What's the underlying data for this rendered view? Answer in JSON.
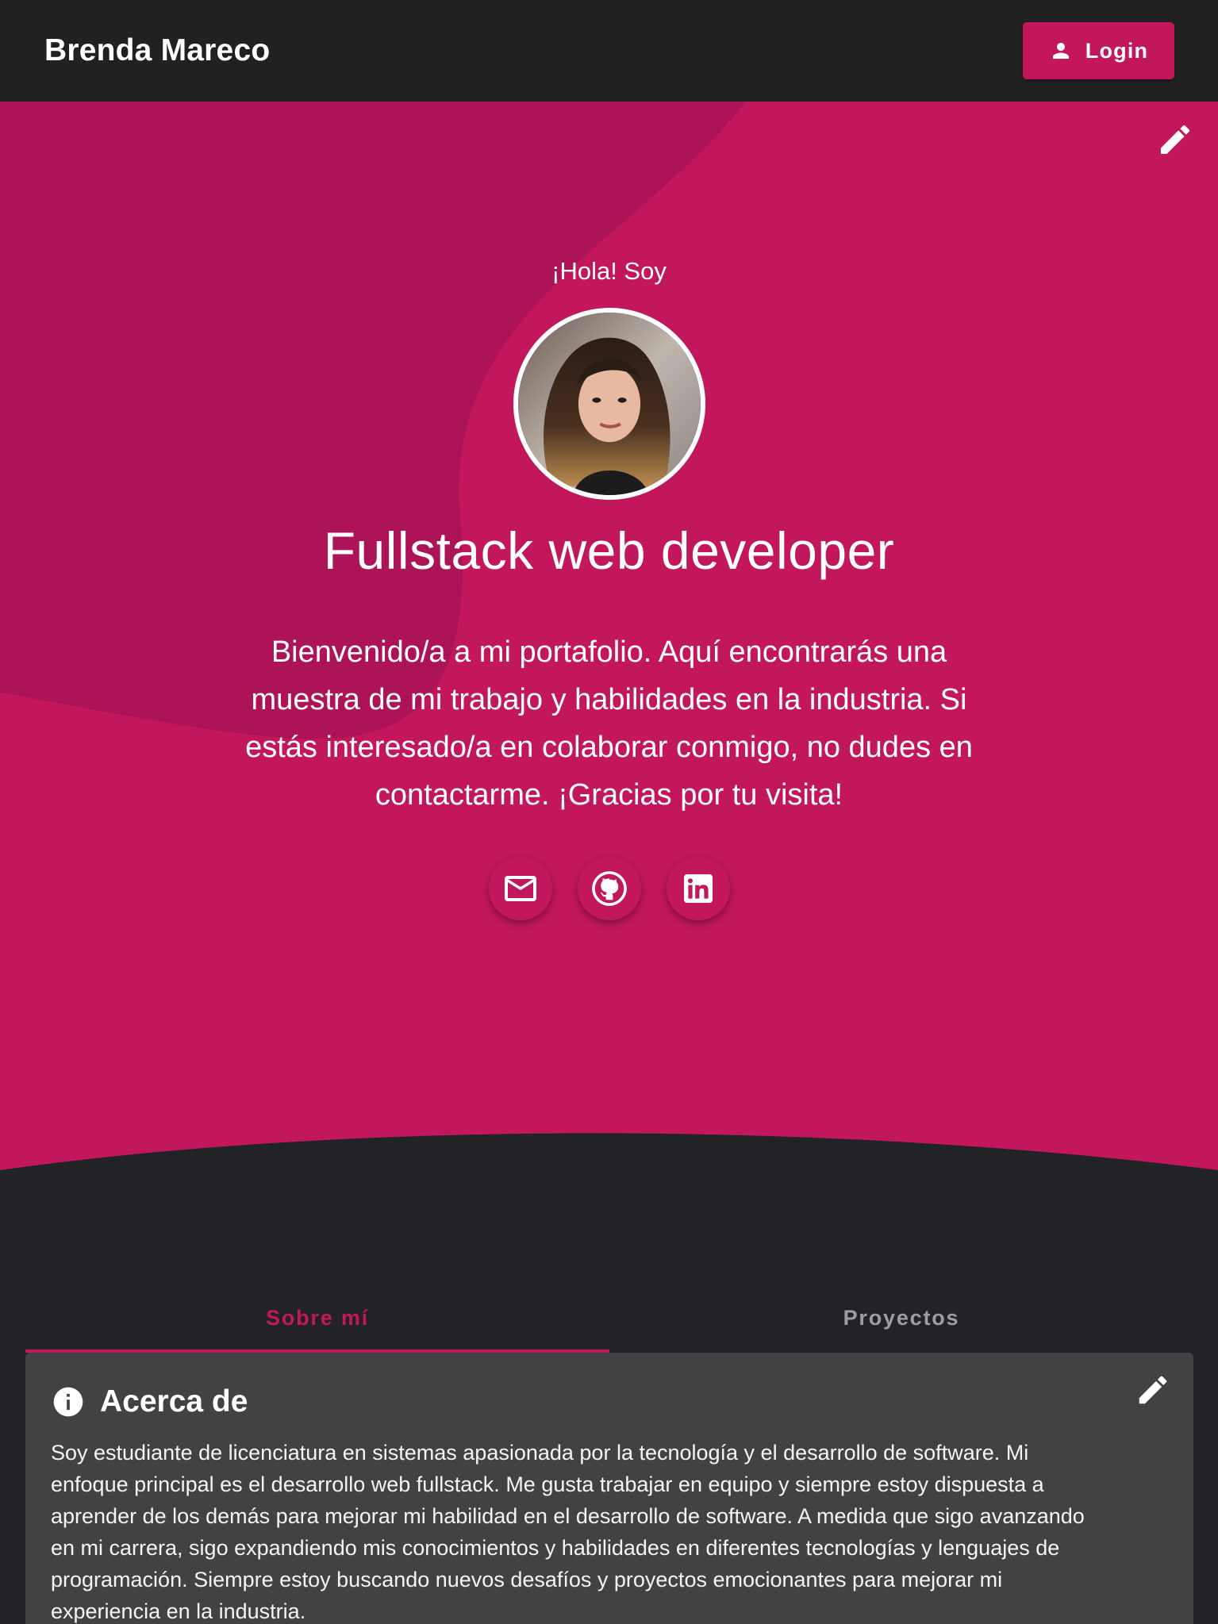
{
  "appbar": {
    "brand": "Brenda Mareco",
    "login_label": "Login",
    "login_icon": "person-icon"
  },
  "hero": {
    "greeting": "¡Hola! Soy",
    "role": "Fullstack web developer",
    "welcome": "Bienvenido/a a mi portafolio. Aquí encontrarás una muestra de mi trabajo y habilidades en la industria. Si estás interesado/a en colaborar conmigo, no dudes en contactarme. ¡Gracias por tu visita!",
    "edit_icon": "pencil-icon",
    "socials": [
      "mail-icon",
      "github-icon",
      "linkedin-icon"
    ]
  },
  "tabs": [
    {
      "label": "Sobre mí",
      "active": true
    },
    {
      "label": "Proyectos",
      "active": false
    }
  ],
  "about": {
    "title": "Acerca de",
    "icon": "info-icon",
    "text": "Soy estudiante de licenciatura en sistemas apasionada por la tecnología y el desarrollo de software. Mi enfoque principal es el desarrollo web fullstack. Me gusta trabajar en equipo y siempre estoy dispuesta a aprender de los demás para mejorar mi habilidad en el desarrollo de software. A medida que sigo avanzando en mi carrera, sigo expandiendo mis conocimientos y habilidades en diferentes tecnologías y lenguajes de programación. Siempre estoy buscando nuevos desafíos y proyectos emocionantes para mejorar mi experiencia en la industria."
  },
  "colors": {
    "accent": "#c2185b",
    "accent_dark": "#ad1457",
    "appbar": "#212121",
    "page_bg": "#212327",
    "card_bg": "#424242"
  }
}
